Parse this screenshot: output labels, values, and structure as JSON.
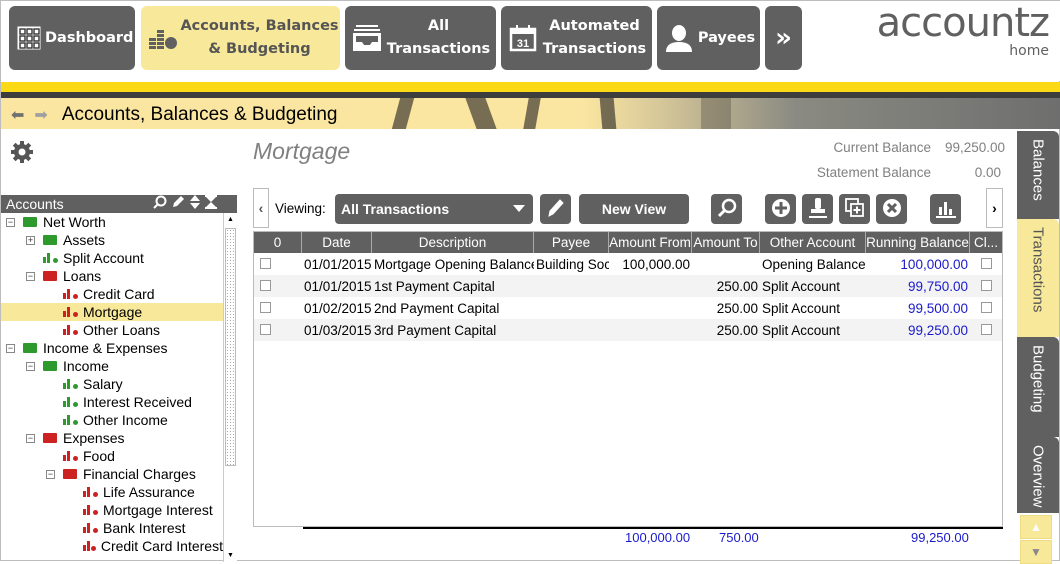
{
  "nav": {
    "items": [
      {
        "label": "Dashboard",
        "icon": "grid-icon",
        "active": false
      },
      {
        "label": "Accounts, Balances & Budgeting",
        "line1": "Accounts, Balances",
        "line2": "& Budgeting",
        "icon": "coins-icon",
        "active": true
      },
      {
        "label": "All Transactions",
        "line1": "All",
        "line2": "Transactions",
        "icon": "inbox-icon",
        "active": false
      },
      {
        "label": "Automated Transactions",
        "line1": "Automated",
        "line2": "Transactions",
        "icon": "calendar-icon",
        "calendar_day": "31",
        "active": false
      },
      {
        "label": "Payees",
        "icon": "person-icon",
        "active": false
      }
    ],
    "more_label": "»"
  },
  "logo": {
    "brand": "accountz",
    "edition": "home"
  },
  "breadcrumb": {
    "back": "⬅",
    "forward": "➡",
    "title": "Accounts, Balances & Budgeting"
  },
  "accounts_panel": {
    "header": "Accounts",
    "tools": [
      "search-icon",
      "pencil-icon",
      "sort-icon",
      "collapse-icon"
    ],
    "tree": [
      {
        "label": "Net Worth",
        "level": 0,
        "type": "folder",
        "color": "#2e9a2e",
        "expander": "−"
      },
      {
        "label": "Assets",
        "level": 1,
        "type": "folder",
        "color": "#2e9a2e",
        "expander": "+"
      },
      {
        "label": "Split Account",
        "level": 1,
        "type": "account",
        "color": "#2e9a2e",
        "expander": ""
      },
      {
        "label": "Loans",
        "level": 1,
        "type": "folder",
        "color": "#cc2222",
        "expander": "−"
      },
      {
        "label": "Credit Card",
        "level": 2,
        "type": "account",
        "color": "#cc2222",
        "expander": ""
      },
      {
        "label": "Mortgage",
        "level": 2,
        "type": "account",
        "color": "#cc2222",
        "expander": "",
        "selected": true
      },
      {
        "label": "Other Loans",
        "level": 2,
        "type": "account",
        "color": "#cc2222",
        "expander": ""
      },
      {
        "label": "Income & Expenses",
        "level": 0,
        "type": "folder",
        "color": "#2e9a2e",
        "expander": "−"
      },
      {
        "label": "Income",
        "level": 1,
        "type": "folder",
        "color": "#2e9a2e",
        "expander": "−"
      },
      {
        "label": "Salary",
        "level": 2,
        "type": "account",
        "color": "#2e9a2e",
        "expander": ""
      },
      {
        "label": "Interest Received",
        "level": 2,
        "type": "account",
        "color": "#2e9a2e",
        "expander": ""
      },
      {
        "label": "Other Income",
        "level": 2,
        "type": "account",
        "color": "#2e9a2e",
        "expander": ""
      },
      {
        "label": "Expenses",
        "level": 1,
        "type": "folder",
        "color": "#cc2222",
        "expander": "−"
      },
      {
        "label": "Food",
        "level": 2,
        "type": "account",
        "color": "#cc2222",
        "expander": ""
      },
      {
        "label": "Financial Charges",
        "level": 2,
        "type": "folder",
        "color": "#cc2222",
        "expander": "−"
      },
      {
        "label": "Life Assurance",
        "level": 3,
        "type": "account",
        "color": "#cc2222",
        "expander": ""
      },
      {
        "label": "Mortgage Interest",
        "level": 3,
        "type": "account",
        "color": "#cc2222",
        "expander": ""
      },
      {
        "label": "Bank Interest",
        "level": 3,
        "type": "account",
        "color": "#cc2222",
        "expander": ""
      },
      {
        "label": "Credit Card Interest",
        "level": 3,
        "type": "account",
        "color": "#cc2222",
        "expander": ""
      }
    ]
  },
  "account": {
    "title": "Mortgage",
    "current_balance_label": "Current Balance",
    "current_balance": "99,250.00",
    "statement_balance_label": "Statement Balance",
    "statement_balance": "0.00"
  },
  "toolbar": {
    "viewing_label": "Viewing:",
    "view_selected": "All Transactions",
    "new_view_label": "New View",
    "buttons": [
      "edit-view-icon",
      "search-icon",
      "add-icon",
      "stamp-icon",
      "duplicate-icon",
      "delete-icon",
      "chart-icon"
    ]
  },
  "grid": {
    "columns": [
      "0",
      "Date",
      "Description",
      "Payee",
      "Amount From",
      "Amount To",
      "Other Account",
      "Running Balance",
      "Cl..."
    ],
    "rows": [
      {
        "date": "01/01/2015",
        "description": "Mortgage Opening Balance",
        "payee": "Building Soc",
        "amount_from": "100,000.00",
        "amount_to": "",
        "other_account": "Opening Balance",
        "running_balance": "100,000.00"
      },
      {
        "date": "01/01/2015",
        "description": "1st Payment Capital",
        "payee": "",
        "amount_from": "",
        "amount_to": "250.00",
        "other_account": "Split Account",
        "running_balance": "99,750.00"
      },
      {
        "date": "01/02/2015",
        "description": "2nd Payment Capital",
        "payee": "",
        "amount_from": "",
        "amount_to": "250.00",
        "other_account": "Split Account",
        "running_balance": "99,500.00"
      },
      {
        "date": "01/03/2015",
        "description": "3rd Payment Capital",
        "payee": "",
        "amount_from": "",
        "amount_to": "250.00",
        "other_account": "Split Account",
        "running_balance": "99,250.00"
      }
    ],
    "totals": {
      "amount_from": "100,000.00",
      "amount_to": "750.00",
      "running_balance": "99,250.00"
    }
  },
  "side_tabs": [
    {
      "label": "Balances",
      "active": false
    },
    {
      "label": "Transactions",
      "active": true
    },
    {
      "label": "Budgeting",
      "active": false
    },
    {
      "label": "Overview",
      "active": false
    }
  ],
  "colors": {
    "accent_yellow": "#fcd915",
    "active_tab": "#f8e89a",
    "button_gray": "#606060",
    "balance_blue": "#1a1acc",
    "asset_green": "#2e9a2e",
    "liability_red": "#cc2222"
  }
}
